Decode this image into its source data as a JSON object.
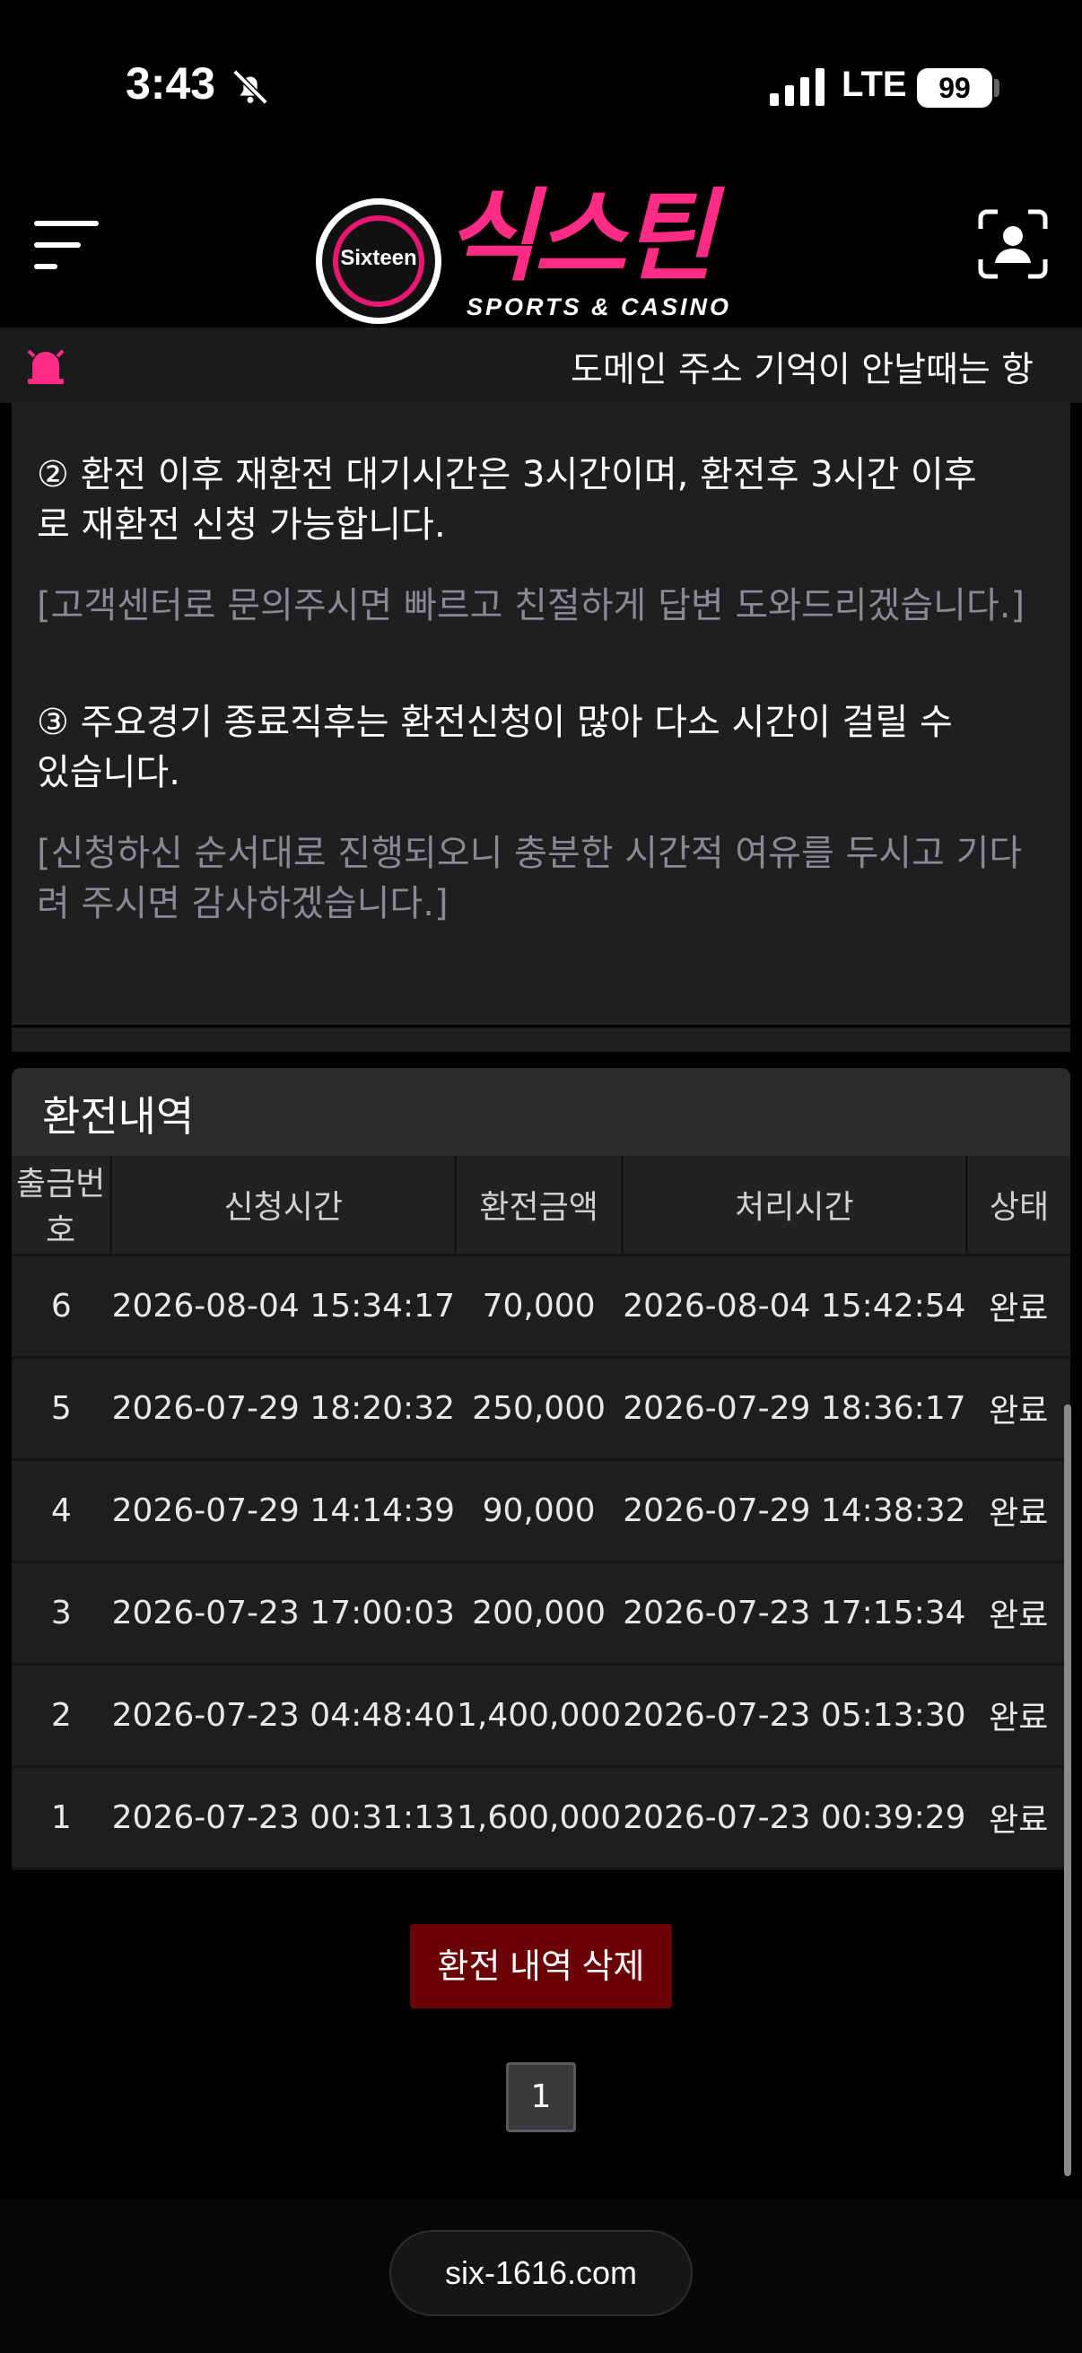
{
  "status_bar": {
    "time": "3:43",
    "network": "LTE",
    "battery": "99"
  },
  "header": {
    "logo_badge": "Sixteen",
    "logo_brand": "식스틴",
    "logo_sub": "SPORTS & CASINO"
  },
  "ticker": {
    "text": "도메인 주소 기억이 안날때는 항"
  },
  "info": {
    "item2_line1": "② 환전 이후 재환전 대기시간은 3시간이며, 환전후 3시간 이후",
    "item2_line2": "로 재환전 신청 가능합니다.",
    "item2_note": "[고객센터로 문의주시면 빠르고 친절하게 답변 도와드리겠습니다.]",
    "item3_line1": "③ 주요경기 종료직후는 환전신청이 많아 다소 시간이 걸릴 수",
    "item3_line2": "있습니다.",
    "item3_note_line1": "[신청하신 순서대로 진행되오니 충분한 시간적 여유를 두시고 기다",
    "item3_note_line2": "려 주시면 감사하겠습니다.]"
  },
  "history": {
    "title": "환전내역",
    "columns": [
      "출금번호",
      "신청시간",
      "환전금액",
      "처리시간",
      "상태"
    ],
    "rows": [
      {
        "no": "6",
        "requested": "2026-08-04 15:34:17",
        "amount": "70,000",
        "processed": "2026-08-04 15:42:54",
        "status": "완료"
      },
      {
        "no": "5",
        "requested": "2026-07-29 18:20:32",
        "amount": "250,000",
        "processed": "2026-07-29 18:36:17",
        "status": "완료"
      },
      {
        "no": "4",
        "requested": "2026-07-29 14:14:39",
        "amount": "90,000",
        "processed": "2026-07-29 14:38:32",
        "status": "완료"
      },
      {
        "no": "3",
        "requested": "2026-07-23 17:00:03",
        "amount": "200,000",
        "processed": "2026-07-23 17:15:34",
        "status": "완료"
      },
      {
        "no": "2",
        "requested": "2026-07-23 04:48:40",
        "amount": "1,400,000",
        "processed": "2026-07-23 05:13:30",
        "status": "완료"
      },
      {
        "no": "1",
        "requested": "2026-07-23 00:31:13",
        "amount": "1,600,000",
        "processed": "2026-07-23 00:39:29",
        "status": "완료"
      }
    ],
    "delete_label": "환전 내역 삭제",
    "page": "1"
  },
  "footer": {
    "url": "six-1616.com"
  },
  "colors": {
    "brand_pink": "#ff2c85",
    "delete_button": "#6b0208"
  }
}
